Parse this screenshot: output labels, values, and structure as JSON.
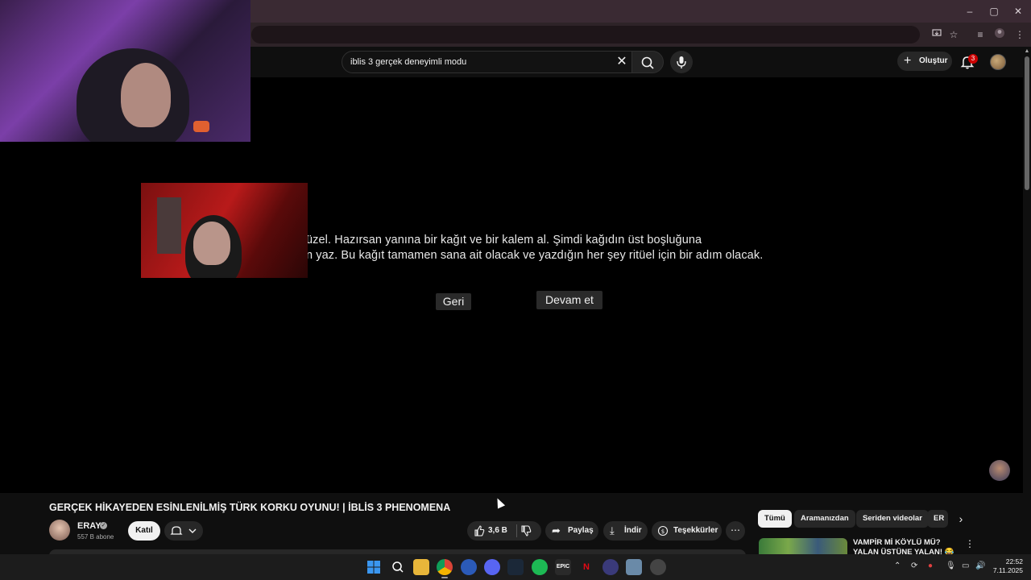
{
  "browser": {
    "window_controls": {
      "minimize": "–",
      "maximize": "▢",
      "close": "✕"
    }
  },
  "header": {
    "search": {
      "value": "iblis 3 gerçek deneyimli modu"
    },
    "create_label": "Oluştur",
    "notification_count": "3"
  },
  "player": {
    "game_text": {
      "line1": "üzel. Hazırsan yanına bir kağıt ve bir kalem al. Şimdi kağıdın üst boşluğuna",
      "line2": "n yaz. Bu kağıt tamamen sana ait olacak ve yazdığın her şey ritüel için bir adım olacak."
    },
    "back_button": "Geri",
    "continue_button": "Devam et"
  },
  "video": {
    "title": "GERÇEK HİKAYEDEN ESİNLENİLMİŞ TÜRK KORKU OYUNU! | İBLİS 3 PHENOMENA",
    "channel_name": "ERAY",
    "subscribers": "557 B abone",
    "join_label": "Katıl",
    "like_count": "3,6 B",
    "share_label": "Paylaş",
    "download_label": "İndir",
    "thanks_label": "Teşekkürler",
    "more_label": "⋯"
  },
  "sidebar": {
    "chips": [
      "Tümü",
      "Aramanızdan",
      "Seriden videolar",
      "ER"
    ],
    "recommendation_title": "VAMPİR Mİ KÖYLÜ MÜ? YALAN ÜSTÜNE YALAN! 😂"
  },
  "taskbar": {
    "time": "22:52",
    "date": "7.11.2025"
  },
  "colors": {
    "background": "#0f0f0f",
    "player": "#000000",
    "accent_red": "#cc0000",
    "chip_active": "#f1f1f1"
  }
}
